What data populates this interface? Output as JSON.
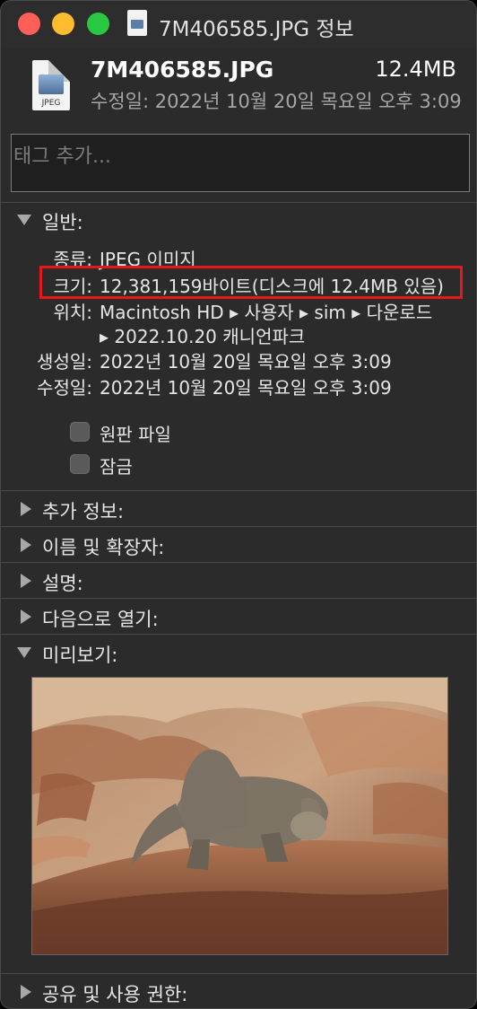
{
  "window": {
    "title": "7M406585.JPG 정보"
  },
  "header": {
    "filename": "7M406585.JPG",
    "size": "12.4MB",
    "modified": "수정일: 2022년 10월 20일 목요일 오후 3:09",
    "icon_label": "JPEG"
  },
  "tags": {
    "placeholder": "태그 추가..."
  },
  "general": {
    "label": "일반:",
    "kind_label": "종류:",
    "kind_value": "JPEG 이미지",
    "size_label": "크기:",
    "size_value": "12,381,159바이트(디스크에 12.4MB 있음)",
    "where_label": "위치:",
    "where_line1": "Macintosh HD ▸ 사용자 ▸ sim ▸ 다운로드",
    "where_line2": "▸ 2022.10.20 캐니언파크",
    "created_label": "생성일:",
    "created_value": "2022년 10월 20일 목요일 오후 3:09",
    "modified_label": "수정일:",
    "modified_value": "2022년 10월 20일 목요일 오후 3:09",
    "stationery_label": "원판 파일",
    "locked_label": "잠금",
    "stationery_checked": false,
    "locked_checked": false
  },
  "sections": {
    "more_info": "추가 정보:",
    "name_ext": "이름 및 확장자:",
    "comments": "설명:",
    "open_with": "다음으로 열기:",
    "preview": "미리보기:",
    "sharing": "공유 및 사용 권한:"
  },
  "colors": {
    "highlight": "#e8151b",
    "background": "#2b2b2b"
  }
}
